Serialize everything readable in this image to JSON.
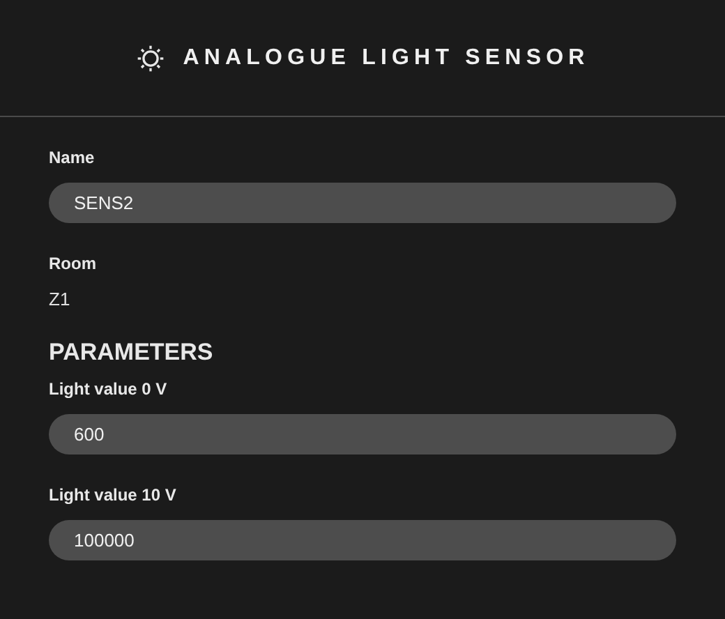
{
  "header": {
    "title": "ANALOGUE LIGHT SENSOR"
  },
  "form": [
    {
      "kind": "input",
      "label": "Name",
      "value": "SENS2"
    },
    {
      "kind": "text",
      "label": "Room",
      "value": "Z1"
    },
    {
      "kind": "heading",
      "text": "PARAMETERS"
    },
    {
      "kind": "input",
      "label": "Light value 0 V",
      "value": "600"
    },
    {
      "kind": "input",
      "label": "Light value 10 V",
      "value": "100000"
    }
  ]
}
